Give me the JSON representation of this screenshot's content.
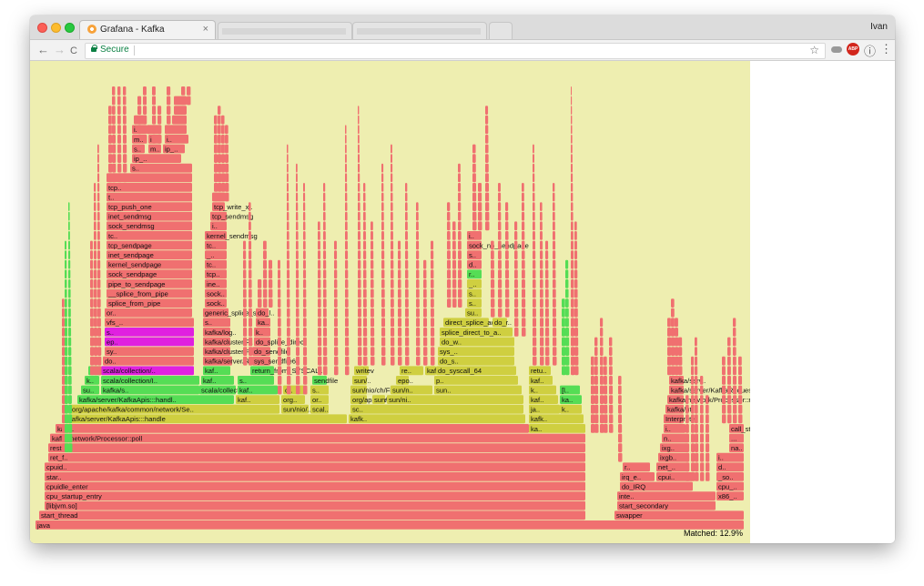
{
  "browser": {
    "tab_title": "Grafana - Kafka",
    "tab_close": "×",
    "user": "Ivan",
    "secure_label": "Secure",
    "nav": {
      "back": "←",
      "forward": "→",
      "reload": "C"
    },
    "icons": [
      "star-icon",
      "cloud-icon",
      "adblock-icon",
      "info-icon",
      "menu-icon"
    ],
    "toolbar_glyphs": {
      "star": "☆",
      "adblock": "ABP",
      "info": "ⓘ",
      "menu": "⋮"
    }
  },
  "colors": {
    "flame_bg": "#eeeeb0",
    "red": "#f07070",
    "green": "#55dd55",
    "yellow": "#cfcf40",
    "magenta": "#e020e0"
  },
  "flamegraph": {
    "matched_label": "Matched: 12.9%",
    "labeled_frames": [
      "java",
      "swapper",
      "start_thread",
      "start_secondary",
      "x86_..",
      "[libjvm.so]",
      "cpu_startup_entry",
      "cpuidle_enter",
      "star..",
      "cpuid..",
      "ret_f..",
      "rest..",
      "inte..",
      "do_IRQ",
      "cpu_..",
      "irq_e..",
      "cpui..",
      "_so..",
      "r..",
      "net_..",
      "d..",
      "ixgb..",
      "i..",
      "ixg..",
      "na..",
      "n..",
      "...",
      "i..",
      "call_stub",
      "Interpreter",
      "kafka/util..",
      "kafka/network/Processor::run",
      "kafka/server/KafkaRequestHandler::run",
      "kafka/serv..",
      "kafka/network/Processor::poll",
      "kafk..",
      "ka..",
      "kafka/server/KafkaApis:::handle",
      "kafk..",
      "kafk..",
      "org/apache/kafka/common/network/Se..",
      "sun/nio/..",
      "scal..",
      "sc..",
      "ja..",
      "k..",
      "kafka/server/KafkaApis:::handl..",
      "kaf..",
      "org..",
      "or..",
      "org/apache/kafka/com..",
      "sun/ni..",
      "sun/ni..",
      "kaf..",
      "ka..",
      "su..",
      "kafka/s..",
      "scala/collection/A..",
      "kaf..",
      "o..",
      "s..",
      "sun/nio/ch/FileChan..",
      "sun/n..",
      "sun..",
      "k..",
      "[l..",
      "k..",
      "scala/collection/I..",
      "kaf..",
      "s..",
      "sendfile",
      "sun/..",
      "epo..",
      "p..",
      "kaf..",
      "kaf..",
      "scala/collection/..",
      "kaf..",
      "return_from_SYSCAL..",
      "writev",
      "re..",
      "kafka/server/Rep..",
      "do_syscall_64",
      "retu..",
      "do..",
      "kafka/server/Rep..",
      "sys_sendfile64",
      "do_s..",
      "sy..",
      "kafka/cluster/P..",
      "do_sendfile",
      "sys_..",
      "ep..",
      "kafka/cluster/P..",
      "do_splice_direct",
      "do_w..",
      "s..",
      "kafka/log..",
      "k..",
      "splice_direct_to_a..",
      "vfs_..",
      "s..",
      "ka..",
      "direct_splice_actor",
      "do_r..",
      "or..",
      "generic_splice_sen..",
      "do_l..",
      "su..",
      "splice_from_pipe",
      "sock..",
      "s..",
      "__splice_from_pipe",
      "sock..",
      "s..",
      "pipe_to_sendpage",
      "ine..",
      "_..",
      "sock_sendpage",
      "tcp..",
      "r..",
      "kernel_sendpage",
      "tc..",
      "d..",
      "inet_sendpage",
      "_..",
      "s..",
      "tcp_sendpage",
      "tc..",
      "sock_no_sendpage",
      "tc..",
      "kernel_sendmsg",
      "i..",
      "sock_sendmsg",
      "i..",
      "inet_sendmsg",
      "tcp_sendmsg",
      "tcp_push_one",
      "tcp_write_x..",
      "t..",
      "t..",
      "tcp..",
      "t..",
      "s..",
      "ip_..",
      "s..",
      "m..",
      "ip_..",
      "m..",
      "i..",
      "i..",
      "i.."
    ]
  }
}
